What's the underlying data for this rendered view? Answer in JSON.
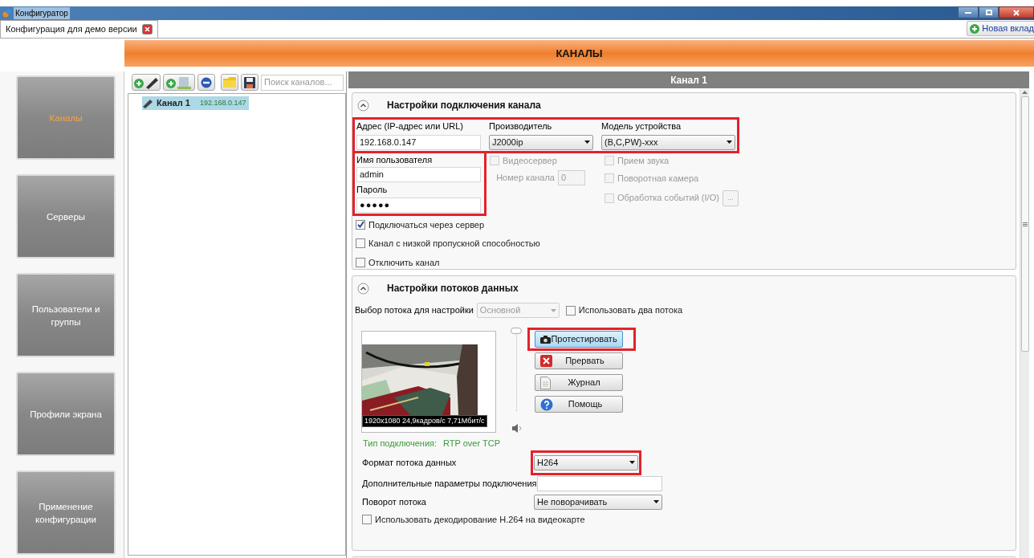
{
  "window": {
    "title": "Конфигуратор"
  },
  "tabs": [
    {
      "label": "Конфигурация для демо версии",
      "selected": true
    }
  ],
  "new_tab": "Новая вклад",
  "banner": "КАНАЛЫ",
  "sidebar": {
    "items": [
      {
        "label": "Каналы",
        "selected": true
      },
      {
        "label": "Серверы",
        "selected": false
      },
      {
        "label": "Пользователи и группы",
        "selected": false
      },
      {
        "label": "Профили экрана",
        "selected": false
      },
      {
        "label": "Применение конфигурации",
        "selected": false
      }
    ]
  },
  "channel_list": {
    "search": {
      "placeholder": "Поиск каналов..."
    },
    "items": [
      {
        "name": "Канал 1",
        "address": "192.168.0.147",
        "selected": true
      }
    ]
  },
  "detail": {
    "title": "Канал 1",
    "connection": {
      "title": "Настройки подключения канала",
      "expanded": true,
      "top_row": {
        "highlighted": true,
        "address": {
          "label": "Адрес (IP-адрес или URL)",
          "value": "192.168.0.147"
        },
        "vendor": {
          "label": "Производитель",
          "value": "J2000ip"
        },
        "model": {
          "label": "Модель устройства",
          "value": "(B,C,PW)-xxx"
        }
      },
      "credentials": {
        "highlighted": true,
        "username": {
          "label": "Имя пользователя",
          "value": "admin"
        },
        "password": {
          "label": "Пароль",
          "value": "●●●●●"
        }
      },
      "video_server": {
        "label": "Видеосервер",
        "checked": false,
        "disabled": true
      },
      "channel_number": {
        "label": "Номер канала",
        "value": "0",
        "disabled": true
      },
      "device_options": [
        {
          "label": "Прием звука",
          "checked": false,
          "disabled": true
        },
        {
          "label": "Поворотная камера",
          "checked": false,
          "disabled": true
        },
        {
          "label": "Обработка событий (I/O)",
          "checked": false,
          "disabled": true
        }
      ],
      "events_button": "...",
      "options": [
        {
          "label": "Подключаться через сервер",
          "checked": true
        },
        {
          "label": "Канал с низкой пропускной способностью",
          "checked": false
        },
        {
          "label": "Отключить канал",
          "checked": false
        }
      ]
    },
    "streams": {
      "title": "Настройки потоков данных",
      "expanded": true,
      "stream_select": {
        "label": "Выбор потока для настройки",
        "value": "Основной",
        "disabled": true
      },
      "two_streams": {
        "label": "Использовать два потока",
        "checked": false
      },
      "preview": {
        "kind": "picture",
        "overlay": "1920x1080  24,9кадров/с  7,71Мбит/с"
      },
      "volume": {
        "level": 1
      },
      "connection_type": {
        "label": "Тип подключения:",
        "value": "RTP over TCP"
      },
      "actions": [
        {
          "label": "Протестировать",
          "kind": "test",
          "highlighted": true
        },
        {
          "label": "Прервать",
          "kind": "stop",
          "highlighted": false
        },
        {
          "label": "Журнал",
          "kind": "log",
          "highlighted": false
        },
        {
          "label": "Помощь",
          "kind": "help",
          "highlighted": false
        }
      ],
      "format": {
        "label": "Формат потока данных",
        "value": "H264",
        "highlighted": true
      },
      "extra_params": {
        "label": "Дополнительные параметры подключения"
      },
      "rotation": {
        "label": "Поворот потока",
        "value": "Не поворачивать"
      },
      "gpu_decode": {
        "label": "Использовать декодирование H.264 на видеокарте",
        "checked": false
      }
    }
  }
}
